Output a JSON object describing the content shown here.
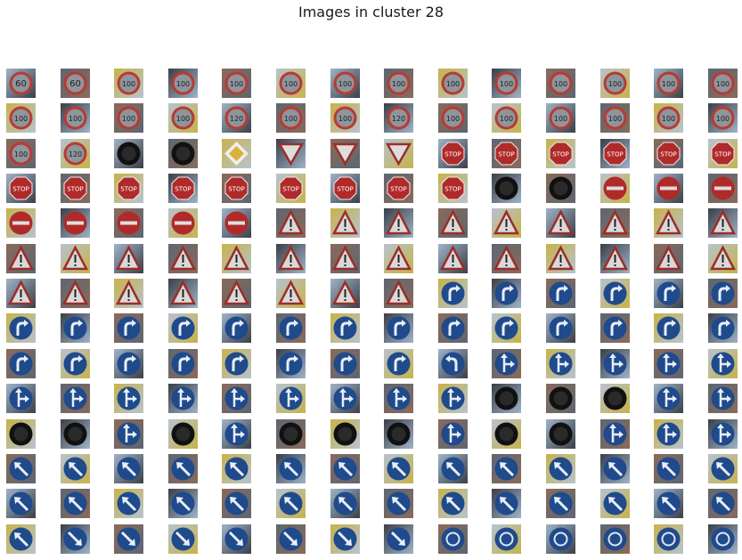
{
  "title": "Images in cluster 28",
  "colors": {
    "sky": "#9fb3c8",
    "stop_red": "#b02a2a",
    "speed_ring": "#b83a32",
    "speed_face": "#8e959c",
    "blue_sign": "#1f4a8c",
    "dark_sign": "#111111",
    "triangle_border": "#9a2e28",
    "foliage": "#c7b24a"
  },
  "grid": {
    "rows": 14,
    "cols": 14,
    "cells": [
      [
        "speed:60",
        "speed:60",
        "speed:100",
        "speed:100",
        "speed:100",
        "speed:100",
        "speed:100",
        "speed:100",
        "speed:100",
        "speed:100",
        "speed:100",
        "speed:100",
        "speed:100",
        "speed:100"
      ],
      [
        "speed:100",
        "speed:100",
        "speed:100",
        "speed:100",
        "speed:120",
        "speed:100",
        "speed:100",
        "speed:120",
        "speed:100",
        "speed:100",
        "speed:100",
        "speed:100",
        "speed:100",
        "speed:100"
      ],
      [
        "speed:100",
        "speed:120",
        "dark-round",
        "dark-round",
        "priority",
        "yield",
        "yield",
        "yield",
        "stop",
        "stop",
        "stop",
        "stop",
        "stop",
        "stop"
      ],
      [
        "stop",
        "stop",
        "stop",
        "stop",
        "stop",
        "stop",
        "stop",
        "stop",
        "stop",
        "dark-round",
        "dark-round",
        "no-entry",
        "no-entry",
        "no-entry"
      ],
      [
        "no-entry",
        "no-entry",
        "no-entry",
        "no-entry",
        "no-entry",
        "warning",
        "warning",
        "warning",
        "warning",
        "warning",
        "warning",
        "warning",
        "warning",
        "warning"
      ],
      [
        "warning",
        "warning",
        "warning",
        "warning",
        "warning",
        "warning",
        "warning",
        "warning",
        "warning",
        "warning",
        "warning",
        "warning",
        "warning",
        "warning"
      ],
      [
        "warning",
        "warning",
        "warning",
        "warning",
        "warning",
        "warning",
        "warning",
        "warning",
        "turn-right",
        "turn-right",
        "turn-right",
        "turn-right",
        "turn-right",
        "turn-right"
      ],
      [
        "turn-right",
        "turn-right",
        "turn-right",
        "turn-right",
        "turn-right",
        "turn-right",
        "turn-right",
        "turn-right",
        "turn-right",
        "turn-right",
        "turn-right",
        "turn-right",
        "turn-right",
        "turn-right"
      ],
      [
        "turn-right",
        "turn-right",
        "turn-right",
        "turn-right",
        "turn-right",
        "turn-right",
        "turn-right",
        "turn-right",
        "turn-left",
        "straight-right",
        "straight-right",
        "straight-right",
        "straight-right",
        "straight-right"
      ],
      [
        "straight-right",
        "straight-right",
        "straight-right",
        "straight-right",
        "straight-right",
        "straight-right",
        "straight-right",
        "straight-right",
        "straight-right",
        "dark-round",
        "dark-round",
        "dark-round",
        "straight-right",
        "straight-right"
      ],
      [
        "dark-round",
        "dark-round",
        "straight-right",
        "dark-round",
        "straight-right",
        "dark-round",
        "dark-round",
        "dark-round",
        "straight-right",
        "dark-round",
        "dark-round",
        "straight-right",
        "straight-right",
        "straight-right"
      ],
      [
        "keep-left",
        "keep-left",
        "keep-left",
        "keep-left",
        "keep-left",
        "keep-left",
        "keep-left",
        "keep-left",
        "keep-left",
        "keep-left",
        "keep-left",
        "keep-left",
        "keep-left",
        "keep-left"
      ],
      [
        "keep-left",
        "keep-left",
        "keep-left",
        "keep-left",
        "keep-left",
        "keep-left",
        "keep-left",
        "keep-left",
        "keep-left",
        "keep-left",
        "keep-left",
        "keep-left",
        "keep-left",
        "keep-left"
      ],
      [
        "keep-left",
        "keep-right",
        "keep-right",
        "keep-right",
        "keep-right",
        "keep-right",
        "keep-right",
        "keep-right",
        "roundabout",
        "roundabout",
        "roundabout",
        "roundabout",
        "roundabout",
        "roundabout"
      ]
    ]
  }
}
